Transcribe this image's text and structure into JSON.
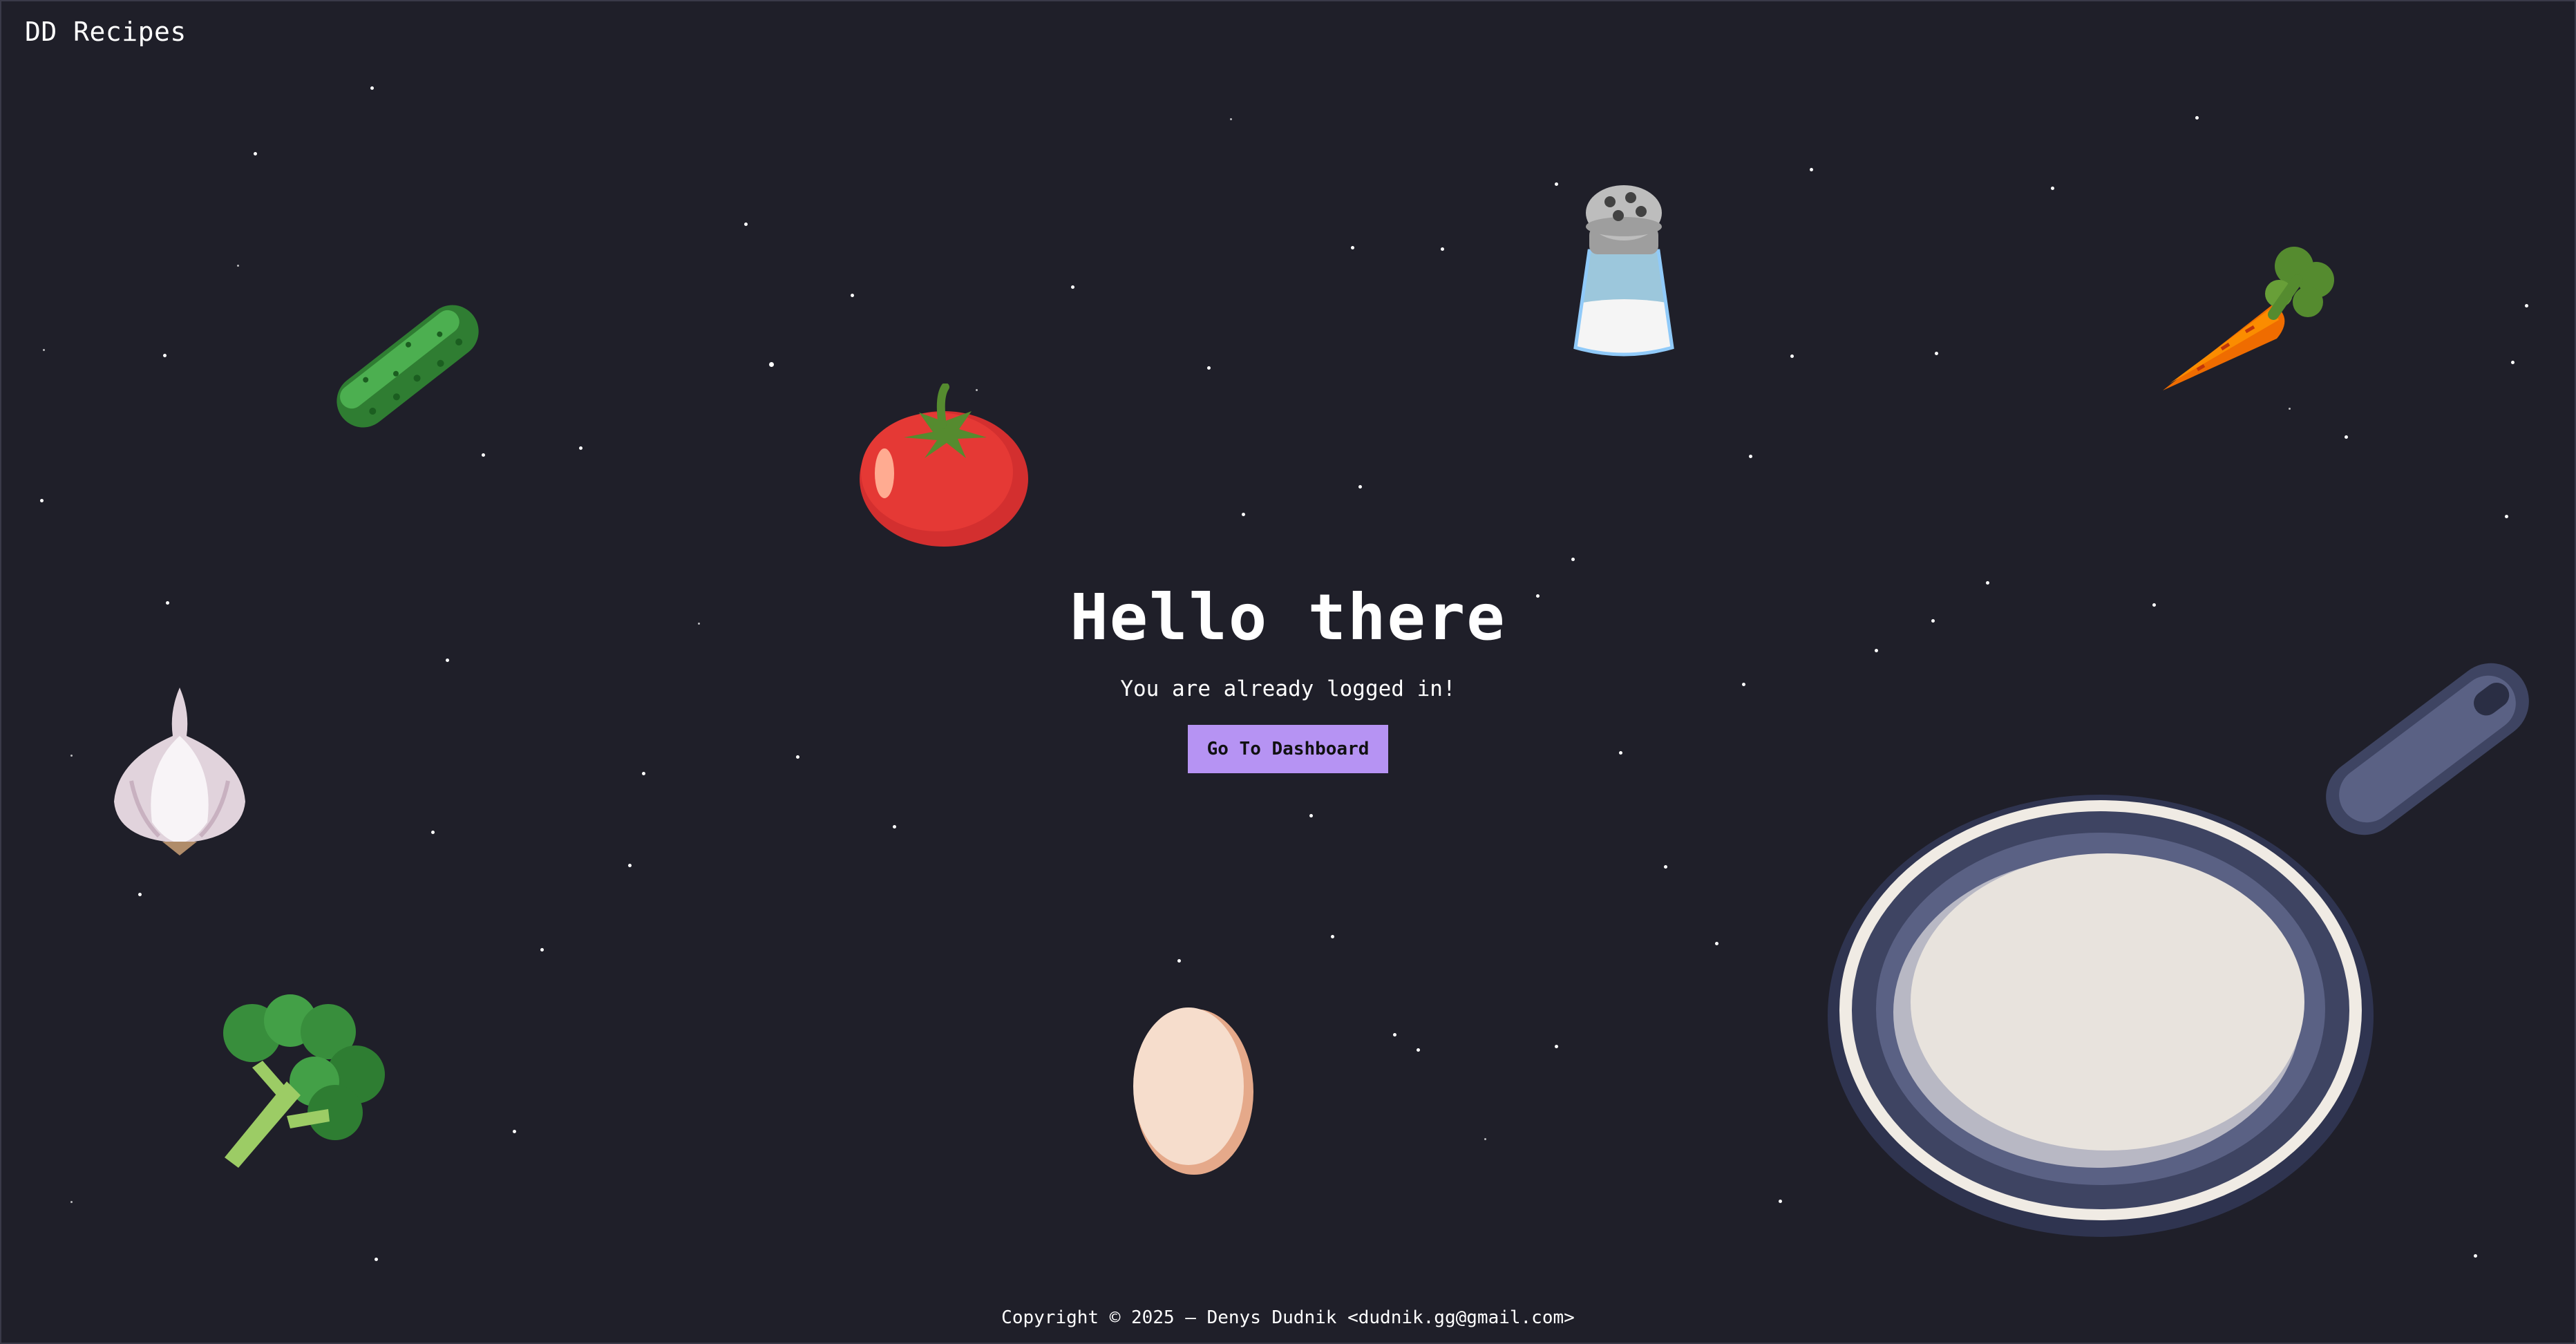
{
  "brand": {
    "name": "DD Recipes"
  },
  "hero": {
    "title": "Hello there",
    "subtitle": "You are already logged in!",
    "cta_label": "Go To Dashboard"
  },
  "footer": {
    "copyright": "Copyright © 2025 – Denys Dudnik <dudnik.gg@gmail.com>"
  },
  "colors": {
    "background": "#1f1f29",
    "accent": "#b693f3",
    "text": "#ffffff"
  },
  "decorations": [
    "cucumber-icon",
    "tomato-icon",
    "salt-shaker-icon",
    "carrot-icon",
    "garlic-icon",
    "broccoli-icon",
    "egg-icon",
    "frying-pan-icon"
  ]
}
